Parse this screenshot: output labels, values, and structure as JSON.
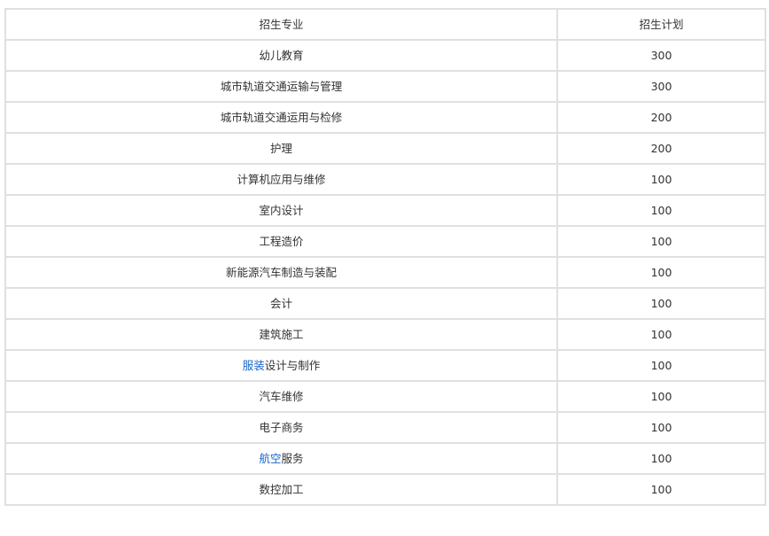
{
  "table": {
    "headers": [
      "招生专业",
      "招生计划"
    ],
    "rows": [
      {
        "major": "幼儿教育",
        "plan": "300"
      },
      {
        "major": "城市轨道交通运输与管理",
        "plan": "300"
      },
      {
        "major": "城市轨道交通运用与检修",
        "plan": "200"
      },
      {
        "major": "护理",
        "plan": "200"
      },
      {
        "major": "计算机应用与维修",
        "plan": "100"
      },
      {
        "major": "室内设计",
        "plan": "100"
      },
      {
        "major": "工程造价",
        "plan": "100"
      },
      {
        "major": "新能源汽车制造与装配",
        "plan": "100"
      },
      {
        "major": "会计",
        "plan": "100"
      },
      {
        "major": "建筑施工",
        "plan": "100"
      },
      {
        "major_link": "服装",
        "major_rest": "设计与制作",
        "plan": "100"
      },
      {
        "major": "汽车维修",
        "plan": "100"
      },
      {
        "major": "电子商务",
        "plan": "100"
      },
      {
        "major_link": "航空",
        "major_rest": "服务",
        "plan": "100"
      },
      {
        "major": "数控加工",
        "plan": "100"
      }
    ]
  },
  "colors": {
    "border": "#e0e0e0",
    "text": "#333333",
    "link": "#1a64c8"
  }
}
